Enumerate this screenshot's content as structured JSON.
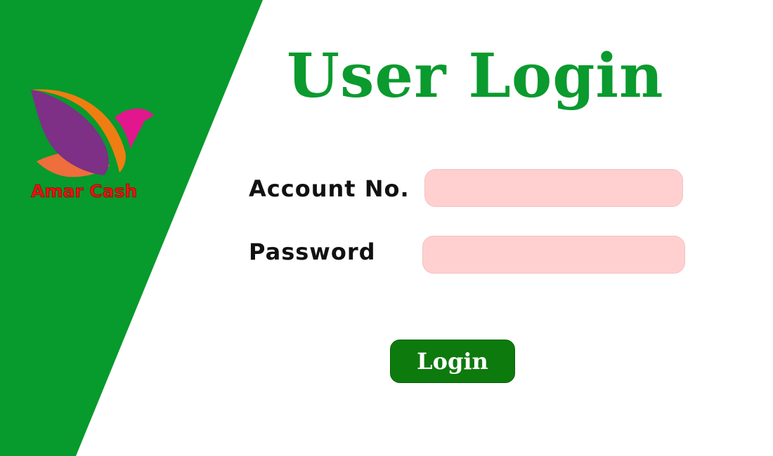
{
  "theme": {
    "panel_color": "#079a2c",
    "title_color": "#0a9a2e",
    "input_background": "#ffd0cf",
    "button_color": "#0d7a0d",
    "brand_text_color": "#ee1111"
  },
  "brand": {
    "name": "Amar Cash",
    "logo_icon": "bird-logo-icon"
  },
  "page_title": "User Login",
  "form": {
    "account_label": "Account No.",
    "account_value": "",
    "password_label": "Password",
    "password_value": "",
    "submit_label": "Login"
  }
}
